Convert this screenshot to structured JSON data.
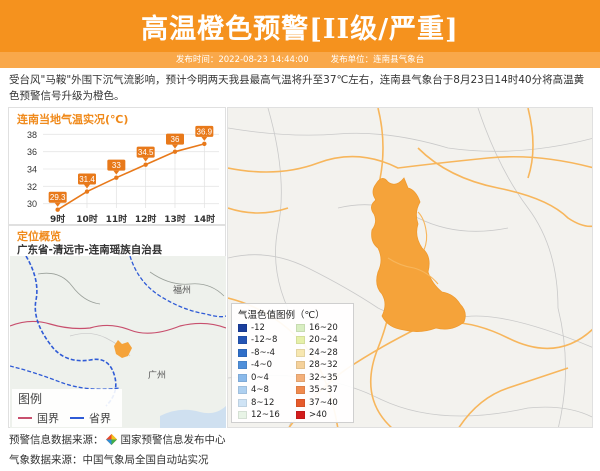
{
  "header": {
    "title": "高温橙色预警[II级/严重]",
    "publish_time": "发布时间：2022-08-23 14:44:00",
    "publish_unit": "发布单位：连南县气象台"
  },
  "description": "受台风\"马鞍\"外围下沉气流影响，预计今明两天我县最高气温将升至37℃左右，连南县气象台于8月23日14时40分将高温黄色预警信号升级为橙色。",
  "temp_panel": {
    "title": "连南当地气温实况(℃)"
  },
  "chart_data": {
    "type": "line",
    "title": "连南当地气温实况(℃)",
    "categories": [
      "9时",
      "10时",
      "11时",
      "12时",
      "13时",
      "14时"
    ],
    "values": [
      29.3,
      31.4,
      33,
      34.5,
      36,
      36.9
    ],
    "value_labels": [
      "29.3",
      "31.4",
      "33",
      "34.5",
      "36",
      "36.9"
    ],
    "yticks": [
      "30",
      "32",
      "34",
      "36",
      "38"
    ],
    "ylim": [
      29.5,
      38.5
    ],
    "grid": true,
    "color": "#e8791a"
  },
  "location": {
    "title": "定位概览",
    "region": "广东省-清远市-连南瑶族自治县"
  },
  "map_legend": {
    "title": "图例",
    "national_border": "国界",
    "provincial_border": "省界",
    "national_color": "#c8506e",
    "provincial_color": "#2f5bd6",
    "cities": [
      "福州",
      "广州"
    ]
  },
  "temp_legend": {
    "title": "气温色值图例（℃）",
    "items": [
      {
        "label": "-12",
        "color": "#1a3e9c"
      },
      {
        "label": "-12~8",
        "color": "#2455b5"
      },
      {
        "label": "-8~-4",
        "color": "#2f6ec8"
      },
      {
        "label": "-4~0",
        "color": "#4f8fda"
      },
      {
        "label": "0~4",
        "color": "#8ab9ea"
      },
      {
        "label": "4~8",
        "color": "#aed0f0"
      },
      {
        "label": "8~12",
        "color": "#cfe3f5"
      },
      {
        "label": "12~16",
        "color": "#e8f4e6"
      },
      {
        "label": "16~20",
        "color": "#d8eec1"
      },
      {
        "label": "20~24",
        "color": "#e6f0a8"
      },
      {
        "label": "24~28",
        "color": "#f7e7b0"
      },
      {
        "label": "28~32",
        "color": "#f5d19a"
      },
      {
        "label": "32~35",
        "color": "#f4b07a"
      },
      {
        "label": "35~37",
        "color": "#f08a4e"
      },
      {
        "label": "37~40",
        "color": "#e65a2a"
      },
      {
        "label": ">40",
        "color": "#d21c1c"
      }
    ]
  },
  "sources": {
    "warning_label": "预警信息数据来源：",
    "warning_source": "国家预警信息发布中心",
    "weather": "气象数据来源：中国气象局全国自动站实况"
  },
  "colors": {
    "accent": "#f5921e",
    "warning_area": "#f5a33a",
    "road": "#f7b65c"
  }
}
